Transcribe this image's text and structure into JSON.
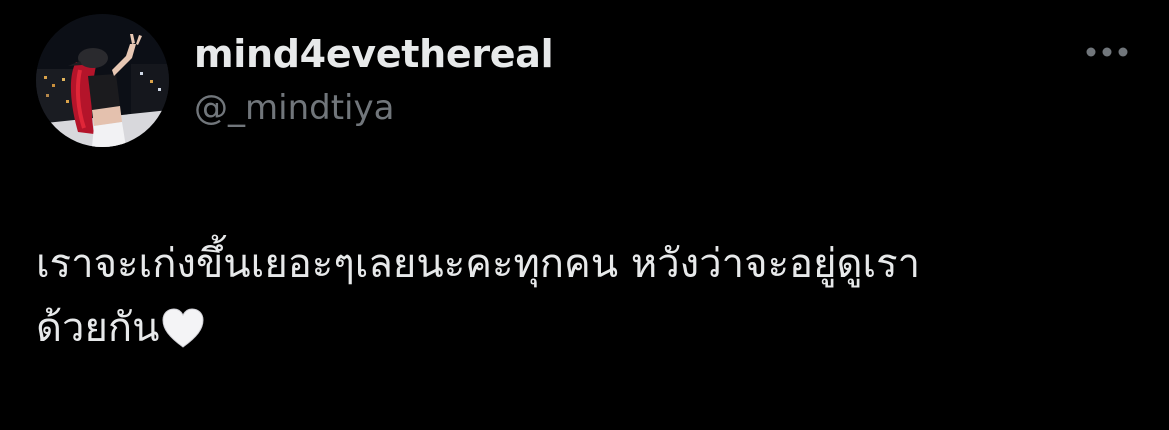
{
  "user": {
    "display_name": "mind4evethereal",
    "handle": "@_mindtiya"
  },
  "actions": {
    "more_icon": "more-horizontal-icon"
  },
  "tweet": {
    "lines": [
      "เราจะเก่งขึ้นเยอะๆเลยนะคะทุกคน หวังว่าจะอยู่ดูเรา",
      "ด้วยกัน"
    ],
    "emoji": "white-heart-icon"
  },
  "colors": {
    "background": "#000000",
    "primary_text": "#e7e9ea",
    "secondary_text": "#71767b"
  }
}
